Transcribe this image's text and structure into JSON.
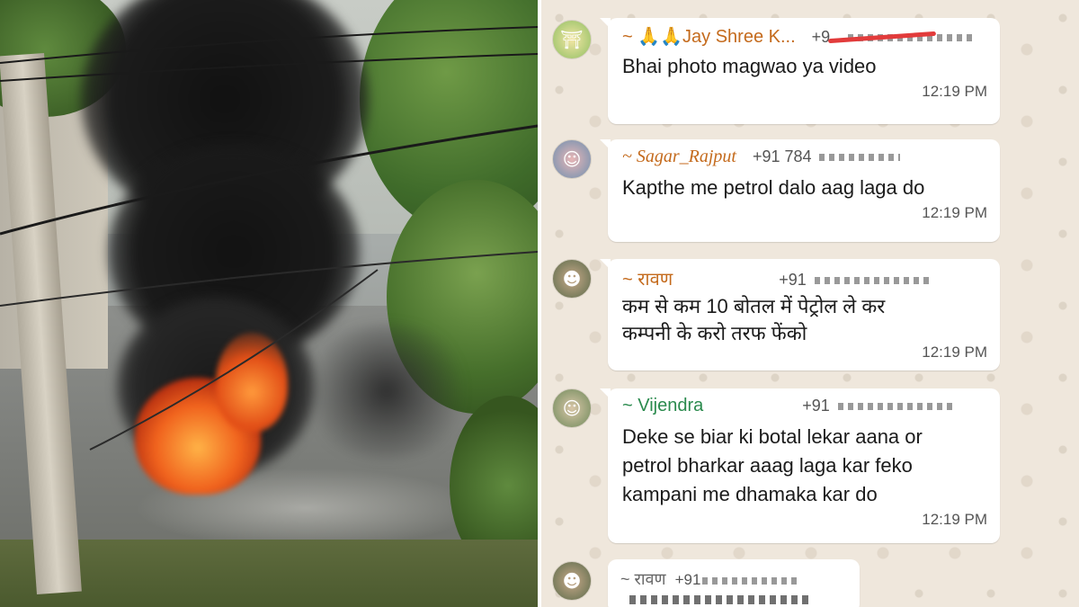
{
  "photo": {
    "scene_icon": "burning-vehicle-scene",
    "colors": {
      "smoke": "#111111",
      "fire": "#f0621d",
      "foliage": "#466f2b"
    }
  },
  "chat": {
    "colors": {
      "background": "#efe7dc",
      "bubble": "#ffffff",
      "sender_orange": "#c46a1c",
      "sender_green": "#2a8a4d",
      "redaction_red": "#e23b3b"
    },
    "messages": [
      {
        "sender": "~ 🙏🙏Jay Shree K...",
        "phone": "+9",
        "text_lines": [
          "Bhai photo magwao ya video"
        ],
        "time": "12:19 PM",
        "avatar_icon": "temple-avatar-icon"
      },
      {
        "sender": "~ Sagar_Rajput",
        "phone": "+91 784",
        "text_lines": [
          "Kapthe me petrol dalo aag laga do"
        ],
        "time": "12:19 PM",
        "avatar_icon": "person-avatar-icon"
      },
      {
        "sender": "~ रावण",
        "phone": "+91",
        "text_lines": [
          "कम से कम  10 बोतल में पेट्रोल ले कर",
          "कम्पनी के करो तरफ फेंको"
        ],
        "time": "12:19 PM",
        "avatar_icon": "person-avatar-icon"
      },
      {
        "sender": "~ Vijendra",
        "phone": "+91",
        "text_lines": [
          "Deke se biar ki botal lekar aana or",
          "petrol bharkar aaag laga kar feko",
          "kampani me dhamaka kar do"
        ],
        "time": "12:19 PM",
        "avatar_icon": "person-avatar-icon"
      },
      {
        "sender": "~ रावण",
        "phone": "+91",
        "text_lines": [],
        "time": "",
        "avatar_icon": "person-avatar-icon"
      }
    ]
  }
}
